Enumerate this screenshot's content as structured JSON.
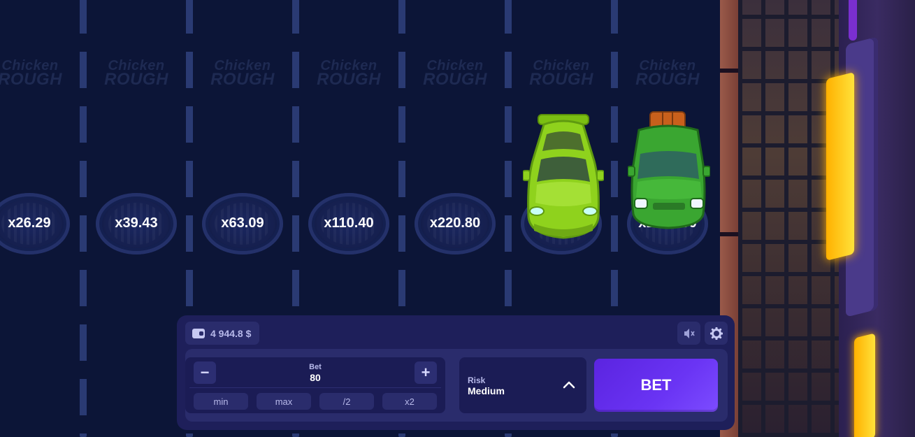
{
  "game": {
    "watermark_line1": "Chicken",
    "watermark_line2": "ROUGH",
    "multipliers": [
      "x26.29",
      "x39.43",
      "x63.09",
      "x110.40",
      "x220.80",
      "",
      "x1200.00"
    ],
    "colors": {
      "road": "#0c1537",
      "lane_line": "#2a3a73",
      "panel": "#1e1f5a",
      "bet_button": "#6a34f4",
      "car_lime": "#8fd21d",
      "car_green": "#3aa631"
    }
  },
  "panel": {
    "balance": "4 944.8 $",
    "wallet_icon": "wallet-icon",
    "mute_icon": "speaker-muted-icon",
    "settings_icon": "gear-icon",
    "bet": {
      "label": "Bet",
      "value": "80",
      "minus": "−",
      "plus": "+",
      "quick": [
        "min",
        "max",
        "/2",
        "x2"
      ]
    },
    "risk": {
      "label": "Risk",
      "value": "Medium"
    },
    "bet_button": "BET"
  }
}
